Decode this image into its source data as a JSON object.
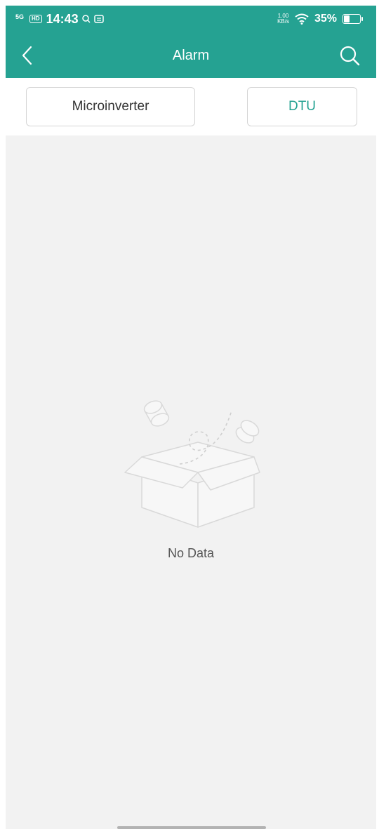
{
  "status_bar": {
    "network": "5G",
    "hd": "HD",
    "time": "14:43",
    "speed_value": "1.00",
    "speed_unit": "KB/s",
    "battery_percent": "35%",
    "battery_level": 0.35
  },
  "nav": {
    "title": "Alarm",
    "back_icon": "chevron-left-icon",
    "search_icon": "search-icon"
  },
  "tabs": [
    {
      "label": "Microinverter"
    },
    {
      "label": "DTU"
    }
  ],
  "empty_state": {
    "text": "No Data",
    "icon": "empty-box-icon"
  },
  "colors": {
    "primary": "#25a292",
    "background": "#f2f2f2",
    "tab_border": "#d4d4d4"
  }
}
